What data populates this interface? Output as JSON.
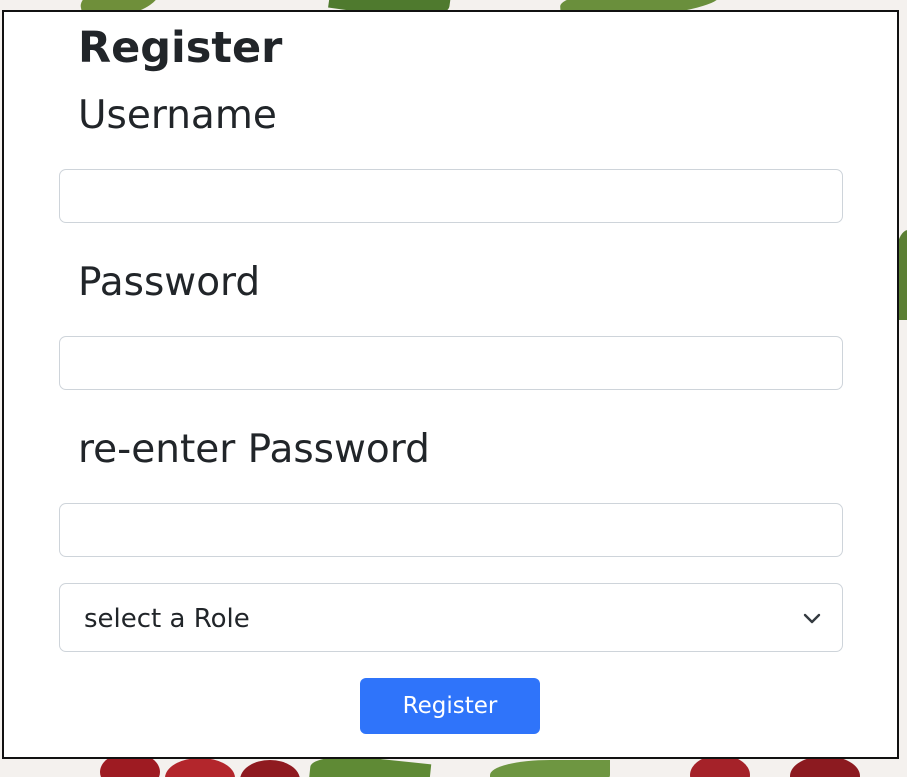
{
  "form": {
    "title": "Register",
    "username_label": "Username",
    "username_value": "",
    "password_label": "Password",
    "password_value": "",
    "reenter_label": "re-enter Password",
    "reenter_value": "",
    "role_select": {
      "selected": "select a Role",
      "icon": "chevron-down-icon"
    },
    "submit_label": "Register"
  },
  "colors": {
    "button": "#2f74fa",
    "border": "#ced4da",
    "card_outline": "#111111",
    "text": "#212529"
  },
  "background": {
    "description_icon": "cherry-pattern"
  }
}
